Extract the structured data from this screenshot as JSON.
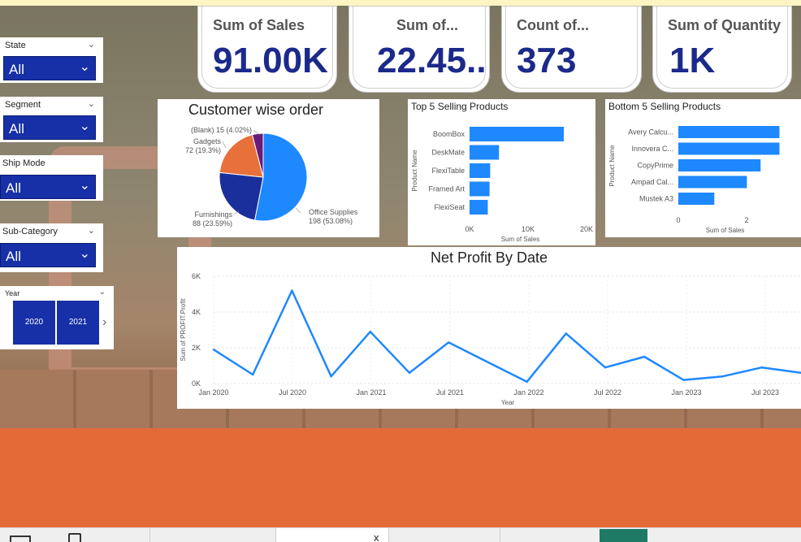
{
  "kpis": [
    {
      "label": "Sum of Sales",
      "value": "91.00K"
    },
    {
      "label": "Sum of...",
      "value": "22.45.."
    },
    {
      "label": "Count of...",
      "value": "373"
    },
    {
      "label": "Sum of Quantity",
      "value": "1K"
    }
  ],
  "slicers": [
    {
      "title": "State",
      "value": "All"
    },
    {
      "title": "Segment",
      "value": "All"
    },
    {
      "title": "Ship Mode",
      "value": "All"
    },
    {
      "title": "Sub-Category",
      "value": "All"
    }
  ],
  "year_slicer": {
    "title": "Year",
    "options": [
      "2020",
      "2021"
    ]
  },
  "colors": {
    "accent": "#1730a8",
    "series": "#1e88ff",
    "kpi_value": "#1b2a8a",
    "orange": "#e46b38"
  },
  "chart_data": [
    {
      "type": "pie",
      "title": "Customer wise order",
      "slices": [
        {
          "label": "Office Supplies",
          "value": 198,
          "percent": "53.08%",
          "text": "Office Supplies\n198 (53.08%)",
          "color": "#1e88ff"
        },
        {
          "label": "Furnishings",
          "value": 88,
          "percent": "23.59%",
          "text": "Furnishings\n88 (23.59%)",
          "color": "#1a2f9a"
        },
        {
          "label": "Gadgets",
          "value": 72,
          "percent": "19.3%",
          "text": "Gadgets\n72 (19.3%)",
          "color": "#e8703a"
        },
        {
          "label": "(Blank)",
          "value": 15,
          "percent": "4.02%",
          "text": "(Blank) 15 (4.02%)",
          "color": "#6a1b7a"
        }
      ]
    },
    {
      "type": "bar",
      "orientation": "horizontal",
      "title": "Top 5 Selling Products",
      "categories": [
        "BoomBox",
        "DeskMate",
        "FlexiTable",
        "Framed Art",
        "FlexiSeat"
      ],
      "values": [
        16000,
        5000,
        3500,
        3400,
        3100
      ],
      "xlabel": "Sum of Sales",
      "ylabel": "Product Name",
      "xlim": [
        0,
        20000
      ],
      "xticks": [
        "0K",
        "10K",
        "20K"
      ]
    },
    {
      "type": "bar",
      "orientation": "horizontal",
      "title": "Bottom 5 Selling Products",
      "categories": [
        "Avery Calcu...",
        "Innovera C...",
        "CopyPrime",
        "Ampad Cal...",
        "Mustek A3"
      ],
      "values": [
        2.95,
        2.95,
        2.4,
        2.0,
        1.05
      ],
      "xlabel": "Sum of Sales",
      "ylabel": "Product Name",
      "xlim": [
        0,
        3.2
      ],
      "xticks": [
        "0",
        "2"
      ]
    },
    {
      "type": "line",
      "title": "Net Profit By Date",
      "xlabel": "Year",
      "ylabel": "Sum of PROFIT.Profit",
      "x_ticks": [
        "Jan 2020",
        "Jul 2020",
        "Jan 2021",
        "Jul 2021",
        "Jan 2022",
        "Jul 2022",
        "Jan 2023",
        "Jul 2023"
      ],
      "y_ticks": [
        "0K",
        "2K",
        "4K",
        "6K"
      ],
      "ylim": [
        0,
        6000
      ],
      "series": [
        {
          "values": [
            1900,
            500,
            5200,
            400,
            2900,
            600,
            2300,
            1200,
            100,
            2800,
            900,
            1500,
            200,
            400,
            900,
            600
          ]
        }
      ]
    }
  ]
}
